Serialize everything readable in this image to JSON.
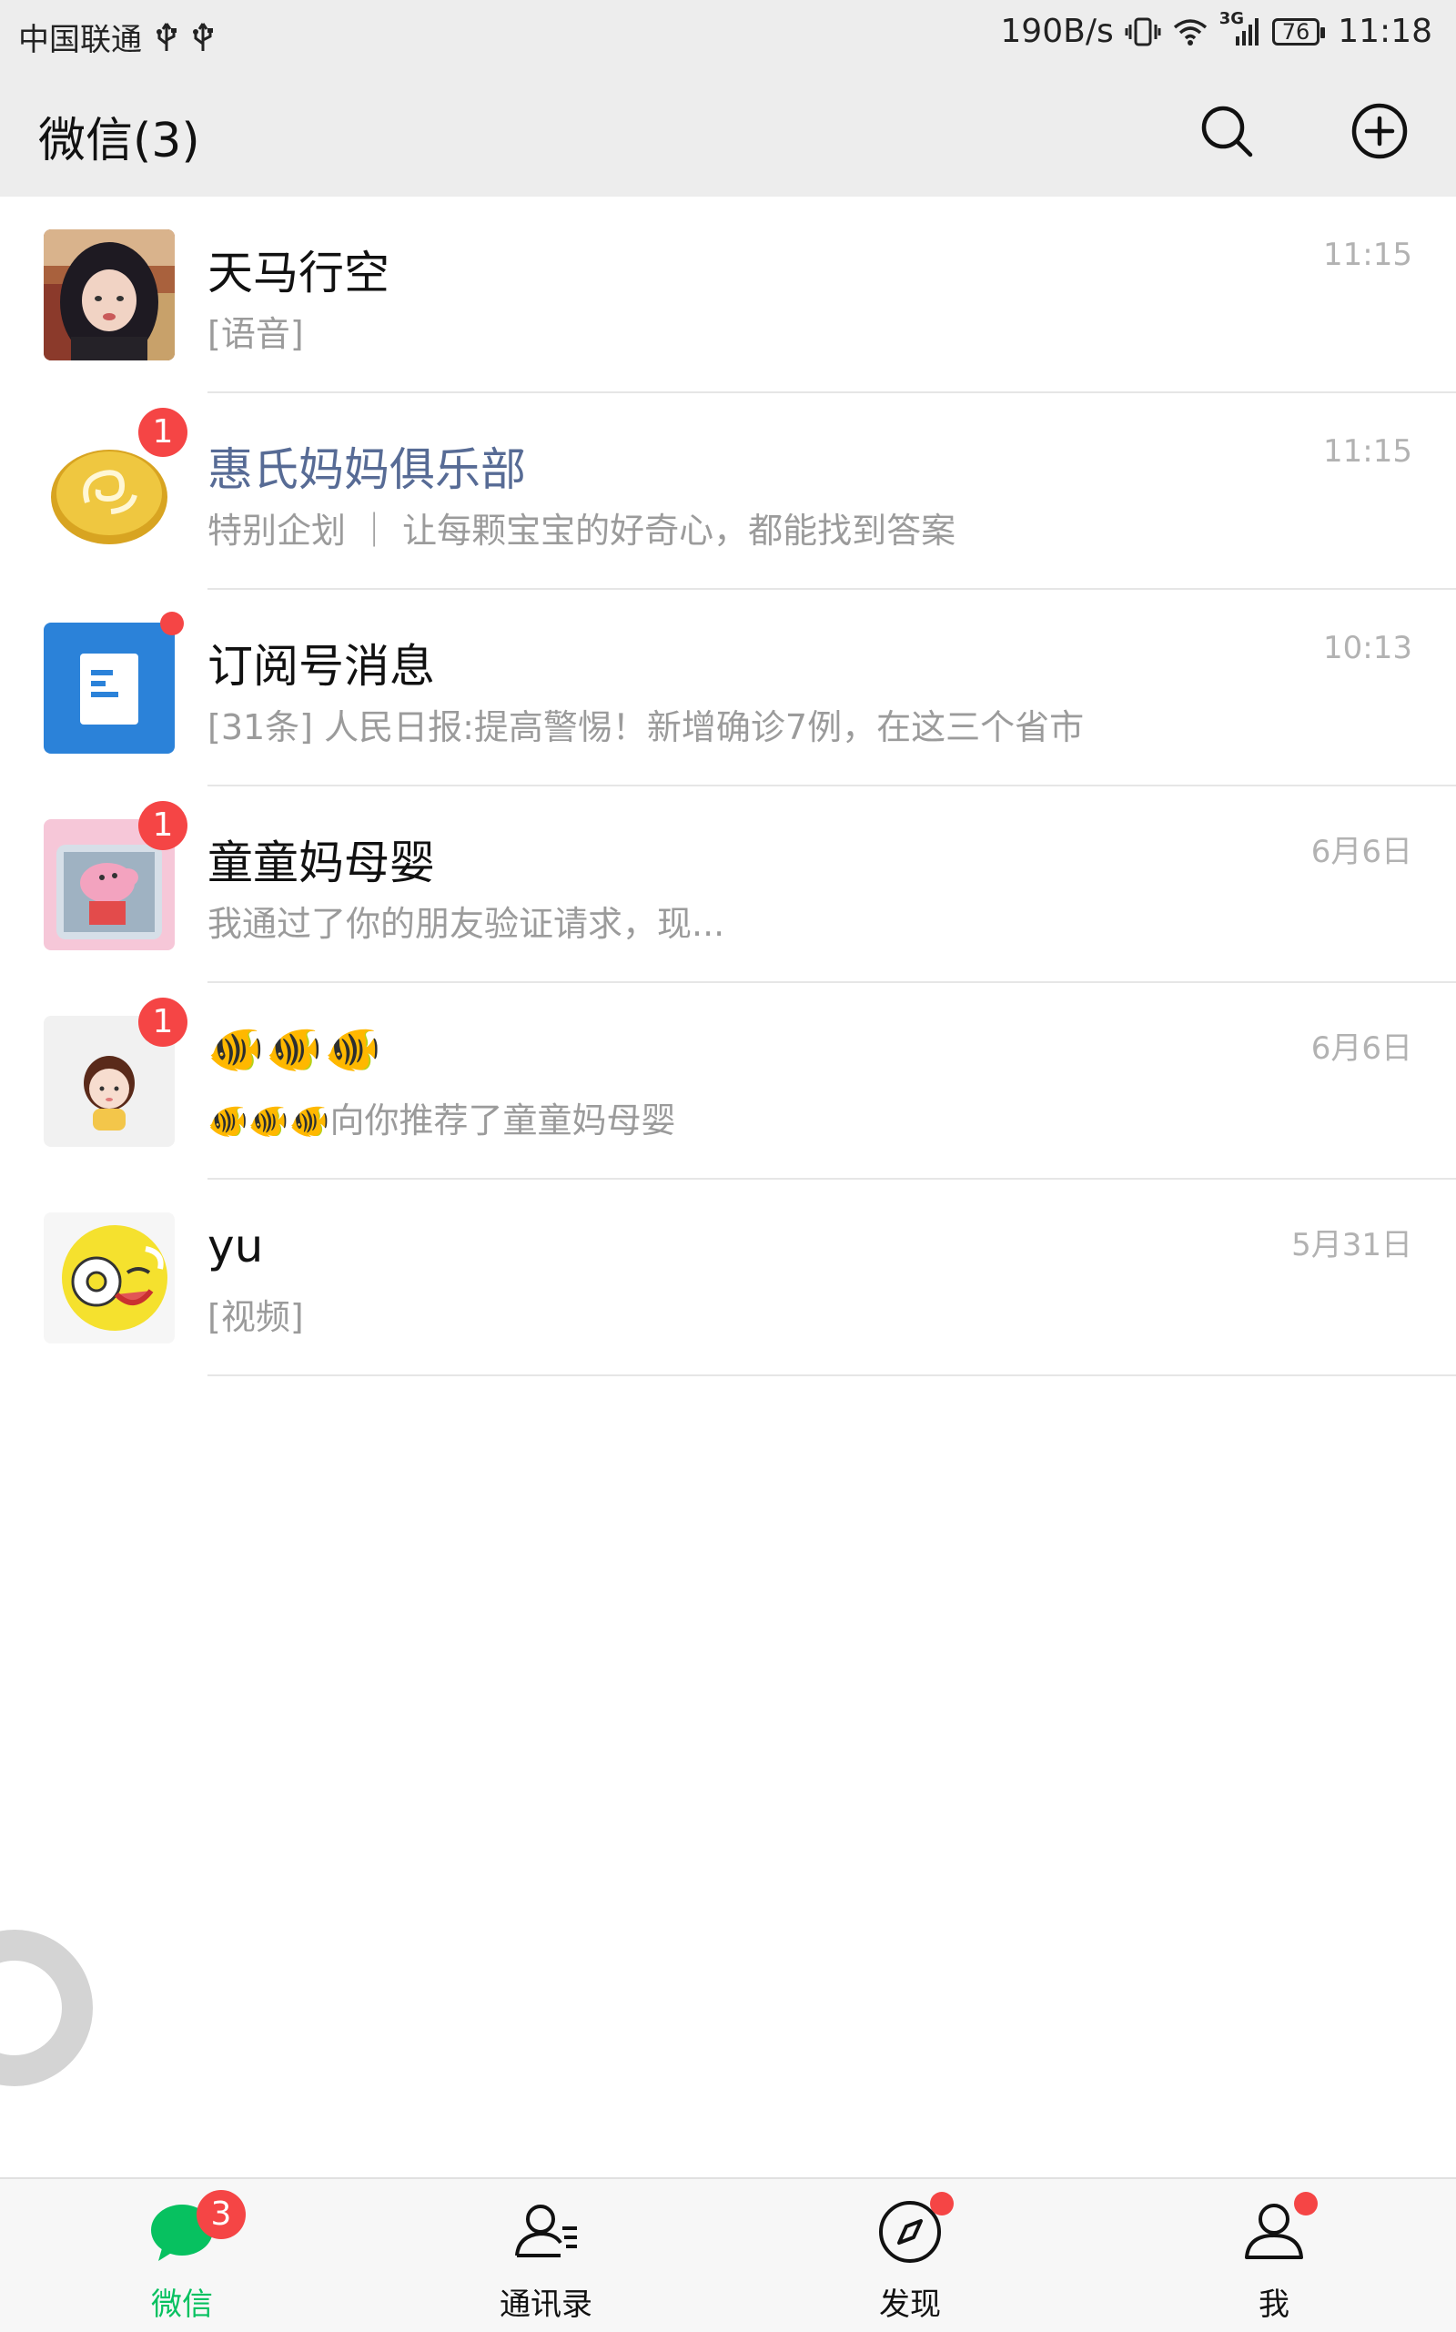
{
  "status_bar": {
    "carrier": "中国联通",
    "net_speed": "190B/s",
    "network_type": "3G",
    "battery": "76",
    "time": "11:18"
  },
  "header": {
    "title": "微信(3)"
  },
  "chats": [
    {
      "name": "天马行空",
      "preview": "[语音]",
      "time": "11:15"
    },
    {
      "name": "惠氏妈妈俱乐部",
      "preview": "特别企划 ｜ 让每颗宝宝的好奇心，都能找到答案",
      "time": "11:15",
      "badge": "1"
    },
    {
      "name": "订阅号消息",
      "preview": "[31条] 人民日报:提高警惕！新增确诊7例，在这三个省市",
      "time": "10:13"
    },
    {
      "name": "童童妈母婴",
      "preview": "我通过了你的朋友验证请求，现...",
      "time": "6月6日",
      "badge": "1"
    },
    {
      "name": "🐠🐠🐠",
      "preview_emoji": "🐠🐠🐠",
      "preview": "向你推荐了童童妈母婴",
      "time": "6月6日",
      "badge": "1"
    },
    {
      "name": "yu",
      "preview": "[视频]",
      "time": "5月31日"
    }
  ],
  "tabbar": {
    "tabs": [
      {
        "label": "微信",
        "badge": "3"
      },
      {
        "label": "通讯录"
      },
      {
        "label": "发现"
      },
      {
        "label": "我"
      }
    ]
  },
  "colors": {
    "accent": "#07c160",
    "badge": "#f54545",
    "header_bg": "#ededed",
    "official_name": "#576b95"
  }
}
